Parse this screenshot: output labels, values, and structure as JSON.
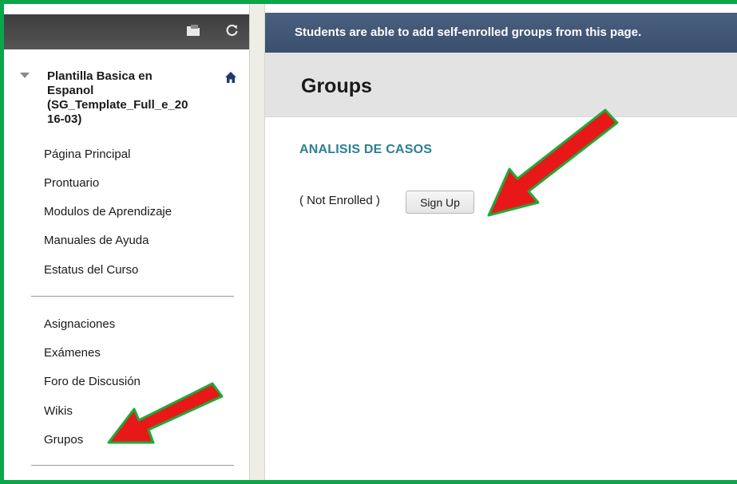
{
  "sidebar": {
    "course_title": "Plantilla Basica en Espanol (SG_Template_Full_e_2016-03)",
    "course_title_lines": [
      "Plantilla Basica en",
      "Espanol",
      "(SG_Template_Full_e_20",
      "16-03)"
    ],
    "toolbar_icons": [
      "folder-icon",
      "refresh-icon"
    ],
    "items_group1": [
      {
        "label": "Página Principal"
      },
      {
        "label": "Prontuario"
      },
      {
        "label": "Modulos de Aprendizaje"
      },
      {
        "label": "Manuales de Ayuda"
      },
      {
        "label": "Estatus del Curso"
      }
    ],
    "items_group2": [
      {
        "label": "Asignaciones"
      },
      {
        "label": "Exámenes"
      },
      {
        "label": "Foro de Discusión"
      },
      {
        "label": "Wikis"
      },
      {
        "label": "Grupos"
      }
    ]
  },
  "main": {
    "banner_text": "Students are able to add self-enrolled groups from this page.",
    "page_title": "Groups",
    "group_name": "ANALISIS DE CASOS",
    "enrollment_status": "( Not Enrolled )",
    "signup_label": "Sign Up"
  },
  "colors": {
    "frame": "#0aa64a",
    "banner": "#3b4f6e",
    "group_heading": "#2a7f96",
    "arrow_fill": "#e81818",
    "arrow_stroke": "#1faa3a"
  }
}
